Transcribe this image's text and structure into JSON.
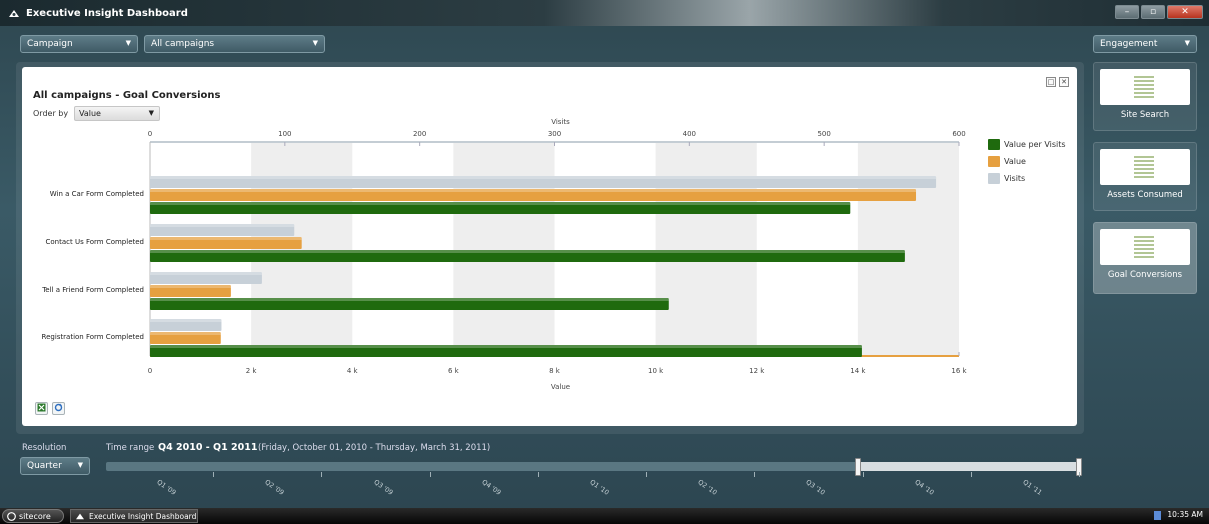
{
  "window": {
    "title": "Executive Insight Dashboard"
  },
  "filters": {
    "segment": "Campaign",
    "scope": "All campaigns",
    "category": "Engagement"
  },
  "report": {
    "title": "All campaigns - Goal Conversions",
    "order_by_label": "Order by",
    "order_by_value": "Value"
  },
  "chart_data": {
    "type": "bar",
    "orientation": "horizontal",
    "categories": [
      "Win a Car Form Completed",
      "Contact Us Form Completed",
      "Tell a Friend Form Completed",
      "Registration Form Completed"
    ],
    "top_axis": {
      "label": "Visits",
      "min": 0,
      "max": 600,
      "ticks": [
        "0",
        "100",
        "200",
        "300",
        "400",
        "500",
        "600"
      ]
    },
    "bottom_axis": {
      "label": "Value",
      "min": 0,
      "max": 16000,
      "ticks": [
        "0",
        "2 k",
        "4 k",
        "6 k",
        "8 k",
        "10 k",
        "12 k",
        "14 k",
        "16 k"
      ]
    },
    "series": [
      {
        "name": "Visits",
        "axis": "top",
        "color": "#c7d0d8",
        "values": [
          583,
          107,
          83,
          53
        ]
      },
      {
        "name": "Value",
        "axis": "bottom",
        "color": "#e6a040",
        "values": [
          15150,
          3000,
          1600,
          1400
        ]
      },
      {
        "name": "Value per Visits",
        "axis": "bottom",
        "color": "#1f6a0e",
        "values": [
          13850,
          14930,
          10260,
          14080
        ]
      }
    ],
    "legend_order": [
      "Value per Visits",
      "Value",
      "Visits"
    ],
    "legend_position": "right"
  },
  "tiles": [
    {
      "label": "Site Search"
    },
    {
      "label": "Assets Consumed"
    },
    {
      "label": "Goal Conversions"
    }
  ],
  "bottom": {
    "resolution_label": "Resolution",
    "resolution_value": "Quarter",
    "time_range_label": "Time range",
    "time_range_value": "Q4 2010 - Q1 2011",
    "time_range_desc": "(Friday, October 01, 2010 - Thursday, March 31, 2011)",
    "quarters": [
      "Q1 '09",
      "Q2 '09",
      "Q3 '09",
      "Q4 '09",
      "Q1 '10",
      "Q2 '10",
      "Q3 '10",
      "Q4 '10",
      "Q1 '11"
    ]
  },
  "taskbar": {
    "start": "sitecore",
    "task": "Executive Insight Dashboard",
    "clock": "10:35 AM"
  }
}
